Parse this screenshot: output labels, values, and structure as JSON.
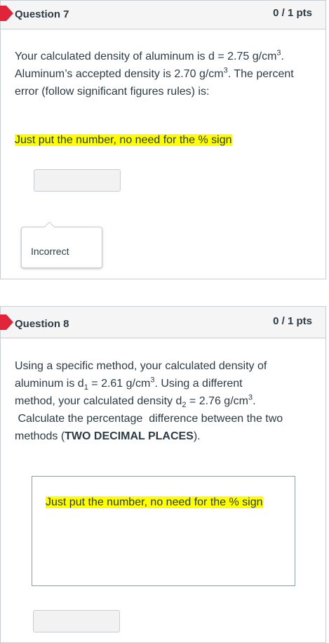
{
  "colors": {
    "flag": "#e0253b",
    "highlight": "#ffff00",
    "header_bg": "#f5f5f5",
    "border": "#c7cdd1"
  },
  "questions": [
    {
      "title": "Question 7",
      "points": "0 / 1 pts",
      "text": {
        "l1a": "Your calculated density of aluminum is d = 2.75  g/cm",
        "l1sup": "3",
        "l1b": ".",
        "l2a": "Aluminum’s accepted density is 2.70 g/cm",
        "l2sup": "3",
        "l2b": ".  The percent",
        "l3": "error (follow significant figures rules) is:"
      },
      "instruction": "Just put the number, no need for the % sign",
      "answer_value": "",
      "result_tag": "Incorrect"
    },
    {
      "title": "Question 8",
      "points": "0 / 1 pts",
      "text": {
        "l1": "Using a specific method, your calculated density of",
        "l2a": "aluminum is d",
        "l2sub": "1",
        "l2b": " = 2.61  g/cm",
        "l2sup": "3",
        "l2c": ". Using a different",
        "l3a": "method, your calculated density d",
        "l3sub": "2",
        "l3b": " = 2.76  g/cm",
        "l3sup": "3",
        "l3c": ".",
        "l4": " Calculate the percentage  difference between the two",
        "l5a": "methods (",
        "l5bold": "TWO DECIMAL PLACES",
        "l5b": ")."
      },
      "instruction": "Just put the number, no need for the % sign",
      "answer_value": ""
    }
  ]
}
